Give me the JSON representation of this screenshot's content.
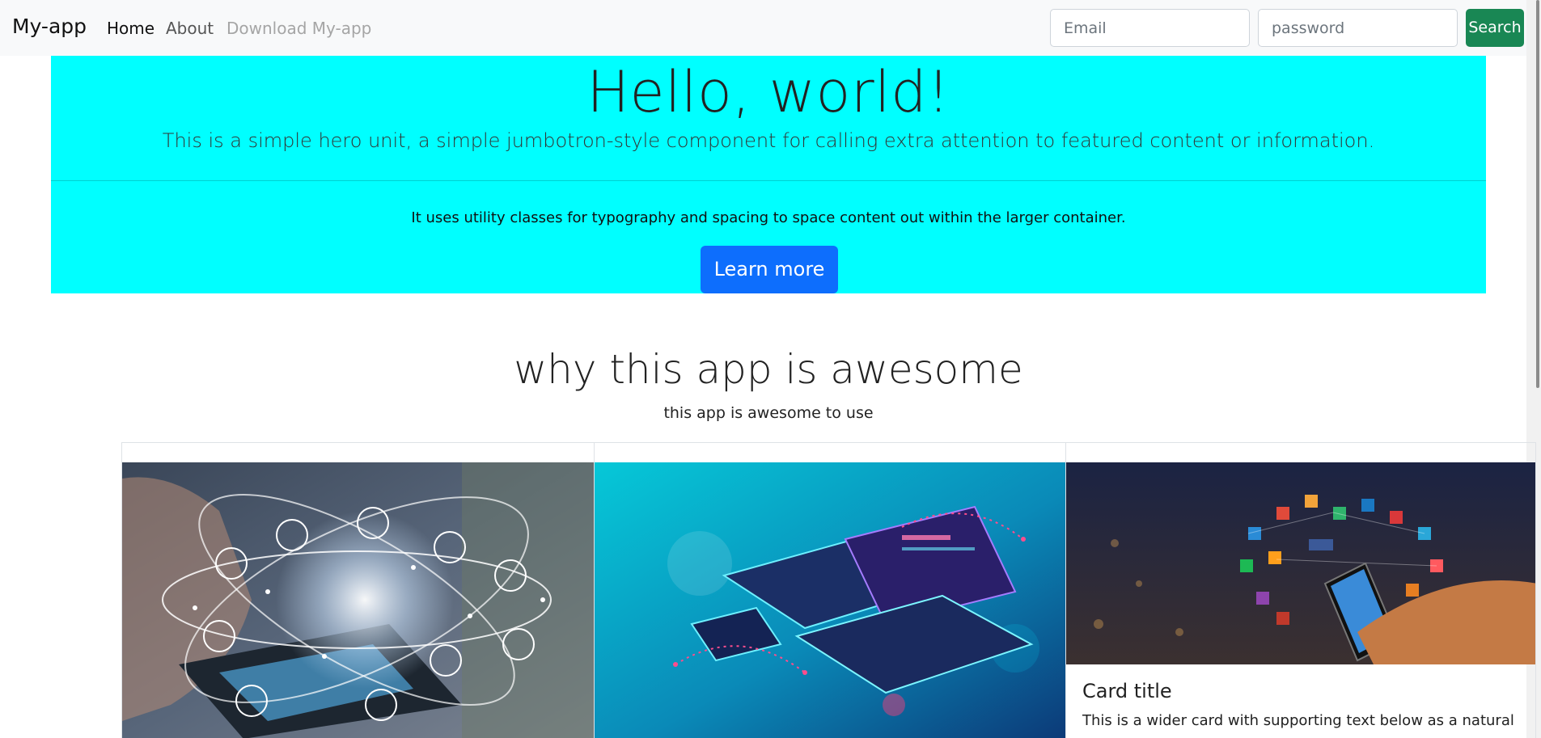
{
  "navbar": {
    "brand": "My-app",
    "links": [
      "Home",
      "About",
      "Download My-app"
    ],
    "email_placeholder": "Email",
    "password_placeholder": "password",
    "search_label": "Search"
  },
  "hero": {
    "title": "Hello, world!",
    "lead": "This is a simple hero unit, a simple jumbotron-style component for calling extra attention to featured content or information.",
    "text": "It uses utility classes for typography and spacing to space content out within the larger container.",
    "button_label": "Learn more"
  },
  "section": {
    "title": "why this app is awesome",
    "subtitle": "this app is awesome to use"
  },
  "cards": [
    {
      "image": "smartphone-network-icons-image"
    },
    {
      "image": "isometric-devices-image"
    },
    {
      "image": "hand-phone-social-icons-image",
      "title": "Card title",
      "text": "This is a wider card with supporting text below as a natural"
    }
  ],
  "colors": {
    "navbar_bg": "#f8f9fa",
    "hero_bg": "#00ffff",
    "primary": "#0d6efd",
    "success": "#198754"
  }
}
